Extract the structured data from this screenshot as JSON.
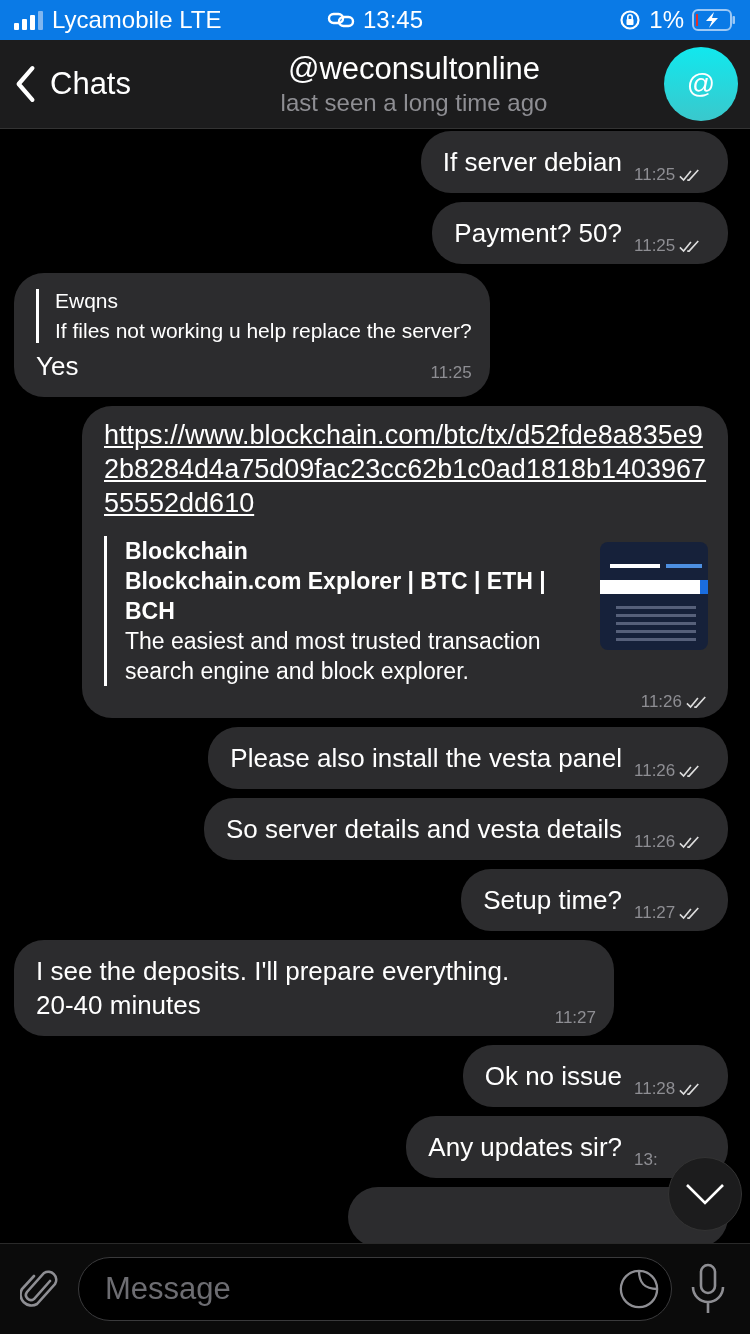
{
  "status_bar": {
    "carrier": "Lycamobile LTE",
    "time": "13:45",
    "battery": "1%"
  },
  "header": {
    "back": "Chats",
    "title": "@weconsultonline",
    "subtitle": "last seen a long time ago",
    "avatar": "@"
  },
  "messages": [
    {
      "kind": "text",
      "outgoing": true,
      "text": "If server debian",
      "time": "11:25",
      "read": true
    },
    {
      "kind": "text",
      "outgoing": true,
      "text": "Payment? 50?",
      "time": "11:25",
      "read": true
    },
    {
      "kind": "reply",
      "outgoing": false,
      "reply_author": "Ewqns",
      "reply_text": "If files not working u help replace the server?",
      "text": "Yes",
      "time": "11:25"
    },
    {
      "kind": "link",
      "outgoing": true,
      "text": "https://www.blockchain.com/btc/tx/d52fde8a835e92b8284d4a75d09fac23cc62b1c0ad1818b140396755552dd610",
      "preview_site": "Blockchain",
      "preview_title": "Blockchain.com Explorer | BTC | ETH | BCH",
      "preview_text": "The easiest and most trusted transaction search engine and block explorer.",
      "time": "11:26",
      "read": true
    },
    {
      "kind": "text",
      "outgoing": true,
      "text": "Please also install the vesta panel",
      "time": "11:26",
      "read": true
    },
    {
      "kind": "text",
      "outgoing": true,
      "text": "So server details and vesta details",
      "time": "11:26",
      "read": true
    },
    {
      "kind": "text",
      "outgoing": true,
      "text": "Setup time?",
      "time": "11:27",
      "read": true
    },
    {
      "kind": "text",
      "outgoing": false,
      "text": "I see the deposits. I'll prepare everything. 20-40 minutes",
      "time": "11:27"
    },
    {
      "kind": "text",
      "outgoing": true,
      "text": "Ok no issue",
      "time": "11:28",
      "read": true
    },
    {
      "kind": "text",
      "outgoing": true,
      "text": "Any updates sir?",
      "time": "13:"
    },
    {
      "kind": "hidden",
      "outgoing": true
    }
  ],
  "composer": {
    "placeholder": "Message"
  }
}
